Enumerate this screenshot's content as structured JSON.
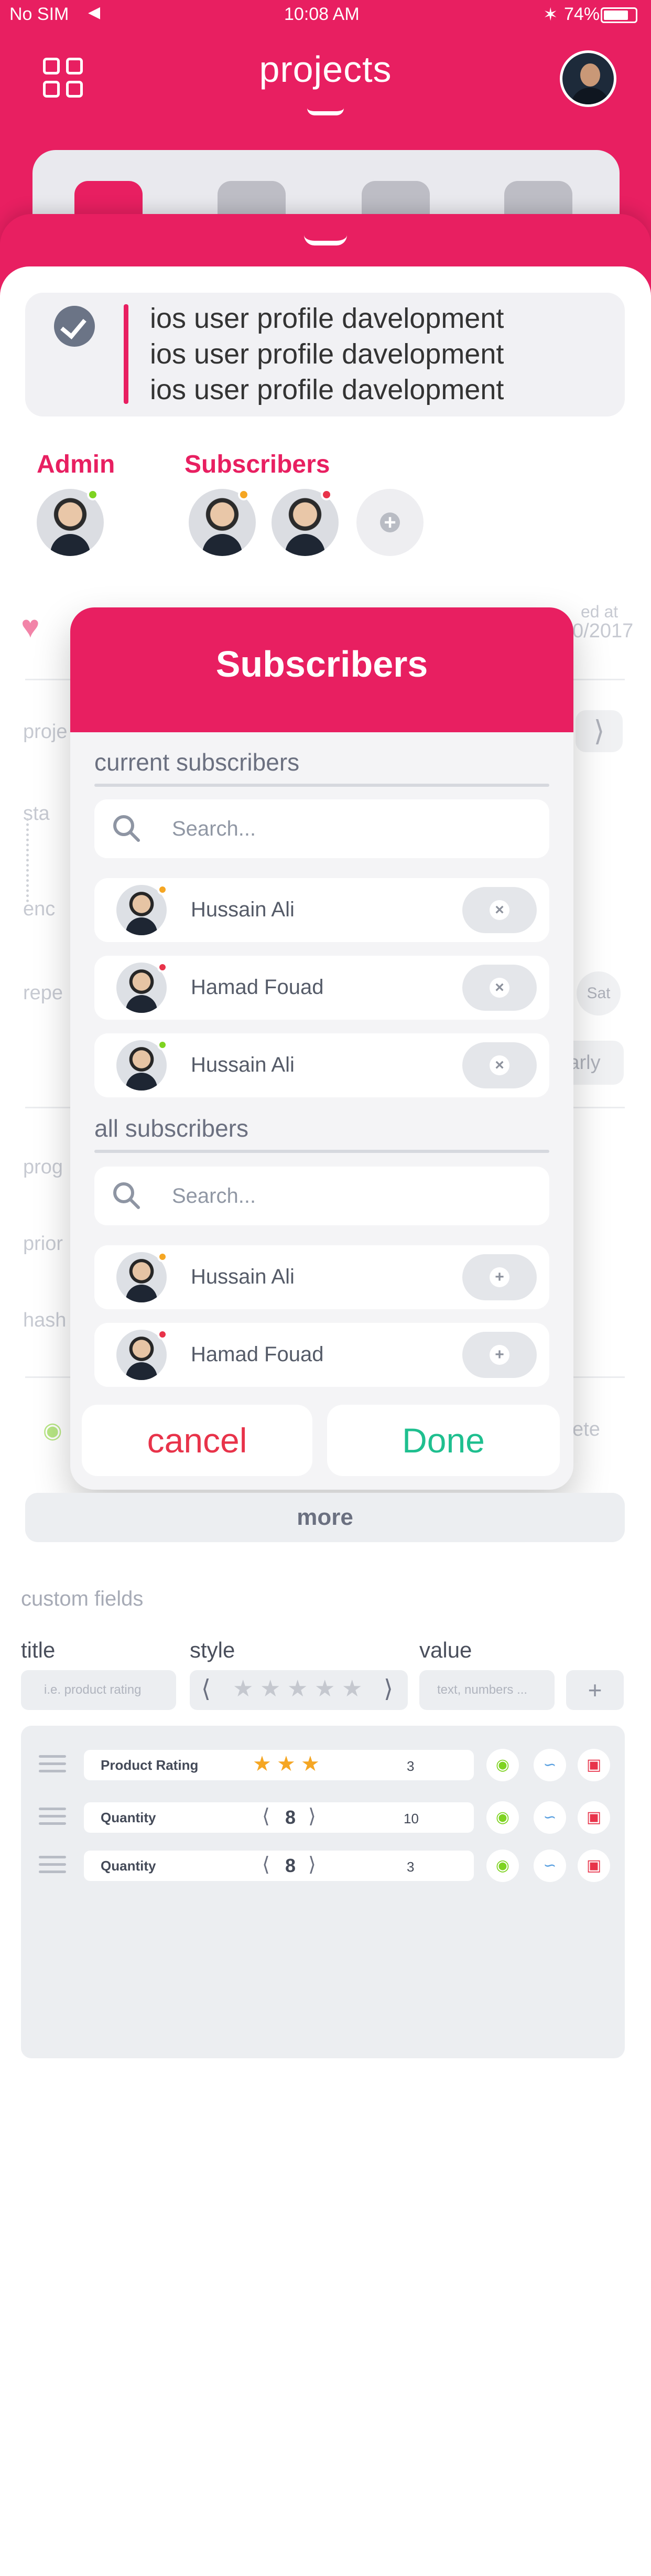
{
  "status_bar": {
    "carrier": "No SIM",
    "time": "10:08 AM",
    "battery": "74%"
  },
  "header": {
    "title": "projects"
  },
  "task": {
    "lines": [
      "ios user profile davelopment",
      "ios user profile davelopment",
      "ios user profile davelopment"
    ]
  },
  "people": {
    "admin_label": "Admin",
    "subscribers_label": "Subscribers"
  },
  "background_fields": {
    "created_at_label": "ed at",
    "created_at_value": "0/2017",
    "project_label": "proje",
    "start_label": "sta",
    "end_label": "enc",
    "repeat_label": "repe",
    "repeat_day": "Sat",
    "repeat_mode": "arly",
    "progress_label": "prog",
    "priority_label": "prior",
    "hashtags_label": "hash",
    "complete_label": "ete"
  },
  "modal": {
    "title": "Subscribers",
    "current_label": "current subscribers",
    "all_label": "all subscribers",
    "search_placeholder": "Search...",
    "current": [
      {
        "name": "Hussain Ali",
        "status_color": "#f5a623"
      },
      {
        "name": "Hamad Fouad",
        "status_color": "#e8334a"
      },
      {
        "name": "Hussain Ali",
        "status_color": "#7ed321"
      }
    ],
    "all": [
      {
        "name": "Hussain Ali",
        "status_color": "#f5a623"
      },
      {
        "name": "Hamad Fouad",
        "status_color": "#e8334a"
      }
    ],
    "cancel_label": "cancel",
    "done_label": "Done"
  },
  "more_label": "more",
  "custom_fields": {
    "section_label": "custom fields",
    "col_title": "title",
    "col_style": "style",
    "col_value": "value",
    "title_placeholder": "i.e. product rating",
    "value_placeholder": "text, numbers ...",
    "add_label": "+",
    "rows": [
      {
        "name": "Product Rating",
        "style": "stars",
        "stars": 3,
        "value": "3"
      },
      {
        "name": "Quantity",
        "style": "stepper",
        "stepper": "8",
        "value": "10"
      },
      {
        "name": "Quantity",
        "style": "stepper",
        "stepper": "8",
        "value": "3"
      }
    ]
  },
  "colors": {
    "accent": "#e81f61",
    "done": "#1fbf8f",
    "cancel": "#e8334a"
  }
}
